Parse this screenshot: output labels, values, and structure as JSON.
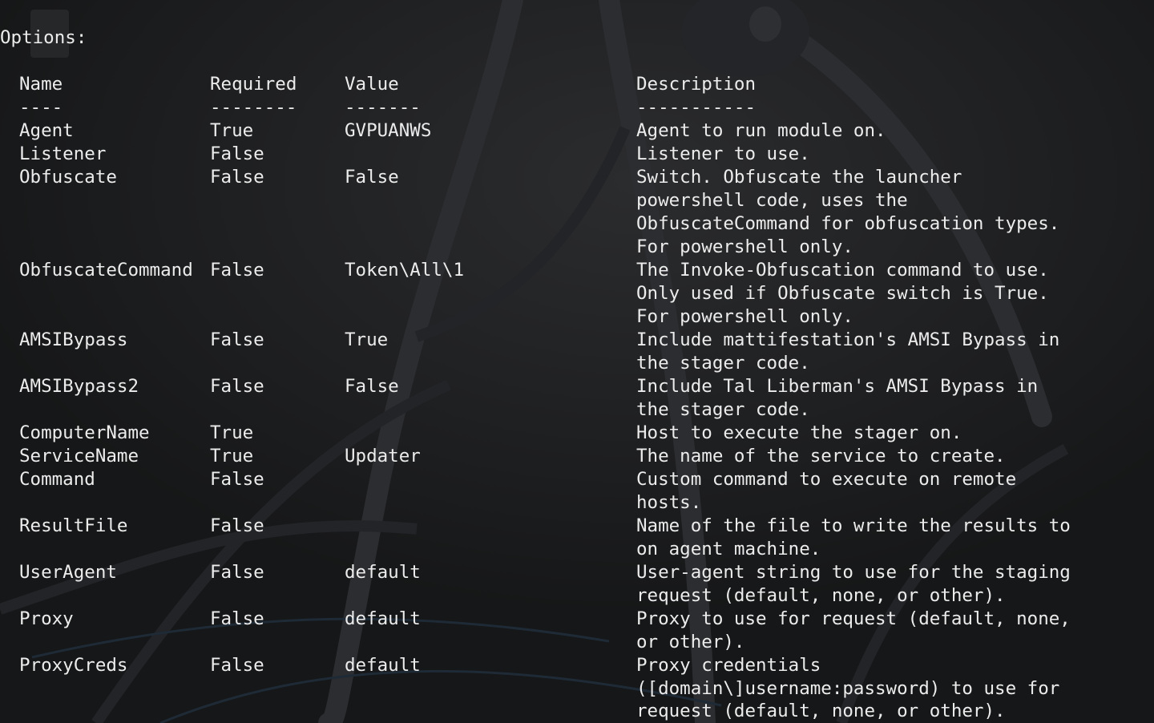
{
  "terminal": {
    "section_heading": "Options:",
    "headers": {
      "name": "Name",
      "required": "Required",
      "value": "Value",
      "description": "Description"
    },
    "underlines": {
      "name": "----",
      "required": "--------",
      "value": "-------",
      "description": "-----------"
    },
    "options": [
      {
        "name": "Agent",
        "required": "True",
        "value": "GVPUANWS",
        "description": [
          "Agent to run module on."
        ]
      },
      {
        "name": "Listener",
        "required": "False",
        "value": "",
        "description": [
          "Listener to use."
        ]
      },
      {
        "name": "Obfuscate",
        "required": "False",
        "value": "False",
        "description": [
          "Switch. Obfuscate the launcher",
          "powershell code, uses the",
          "ObfuscateCommand for obfuscation types.",
          "For powershell only."
        ]
      },
      {
        "name": "ObfuscateCommand",
        "required": "False",
        "value": "Token\\All\\1",
        "description": [
          "The Invoke-Obfuscation command to use.",
          "Only used if Obfuscate switch is True.",
          "For powershell only."
        ]
      },
      {
        "name": "AMSIBypass",
        "required": "False",
        "value": "True",
        "description": [
          "Include mattifestation's AMSI Bypass in",
          "the stager code."
        ]
      },
      {
        "name": "AMSIBypass2",
        "required": "False",
        "value": "False",
        "description": [
          "Include Tal Liberman's AMSI Bypass in",
          "the stager code."
        ]
      },
      {
        "name": "ComputerName",
        "required": "True",
        "value": "",
        "description": [
          "Host to execute the stager on."
        ]
      },
      {
        "name": "ServiceName",
        "required": "True",
        "value": "Updater",
        "description": [
          "The name of the service to create."
        ]
      },
      {
        "name": "Command",
        "required": "False",
        "value": "",
        "description": [
          "Custom command to execute on remote",
          "hosts."
        ]
      },
      {
        "name": "ResultFile",
        "required": "False",
        "value": "",
        "description": [
          "Name of the file to write the results to",
          "on agent machine."
        ]
      },
      {
        "name": "UserAgent",
        "required": "False",
        "value": "default",
        "description": [
          "User-agent string to use for the staging",
          "request (default, none, or other)."
        ]
      },
      {
        "name": "Proxy",
        "required": "False",
        "value": "default",
        "description": [
          "Proxy to use for request (default, none,",
          "or other)."
        ]
      },
      {
        "name": "ProxyCreds",
        "required": "False",
        "value": "default",
        "description": [
          "Proxy credentials",
          "([domain\\]username:password) to use for",
          "request (default, none, or other)."
        ]
      }
    ]
  }
}
